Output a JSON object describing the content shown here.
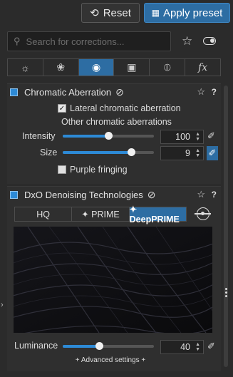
{
  "toolbar": {
    "reset_label": "Reset",
    "apply_label": "Apply preset"
  },
  "search": {
    "placeholder": "Search for corrections..."
  },
  "tabs": [
    {
      "icon": "sun-icon",
      "label": "☼"
    },
    {
      "icon": "color-circles-icon",
      "label": "❀"
    },
    {
      "icon": "lens-icon",
      "label": "◉"
    },
    {
      "icon": "crop-icon",
      "label": "▣"
    },
    {
      "icon": "local-adjust-icon",
      "label": "⦶"
    },
    {
      "icon": "fx-icon",
      "label": "fx"
    }
  ],
  "chromatic": {
    "title": "Chromatic Aberration",
    "lateral_label": "Lateral chromatic aberration",
    "lateral_checked": true,
    "other_label": "Other chromatic aberrations",
    "intensity_label": "Intensity",
    "intensity_value": "100",
    "intensity_fraction": 0.5,
    "size_label": "Size",
    "size_value": "9",
    "size_fraction": 0.75,
    "purple_label": "Purple fringing",
    "purple_checked": false
  },
  "denoise": {
    "title": "DxO Denoising Technologies",
    "modes": [
      "HQ",
      "✦ PRIME",
      "✦ DeepPRIME"
    ],
    "selected_mode": "DeepPRIME",
    "luminance_label": "Luminance",
    "luminance_value": "40",
    "luminance_fraction": 0.4,
    "advanced_label": "+ Advanced settings +"
  },
  "colors": {
    "accent": "#2d6da3",
    "slider_fill": "#2d8ad6"
  }
}
